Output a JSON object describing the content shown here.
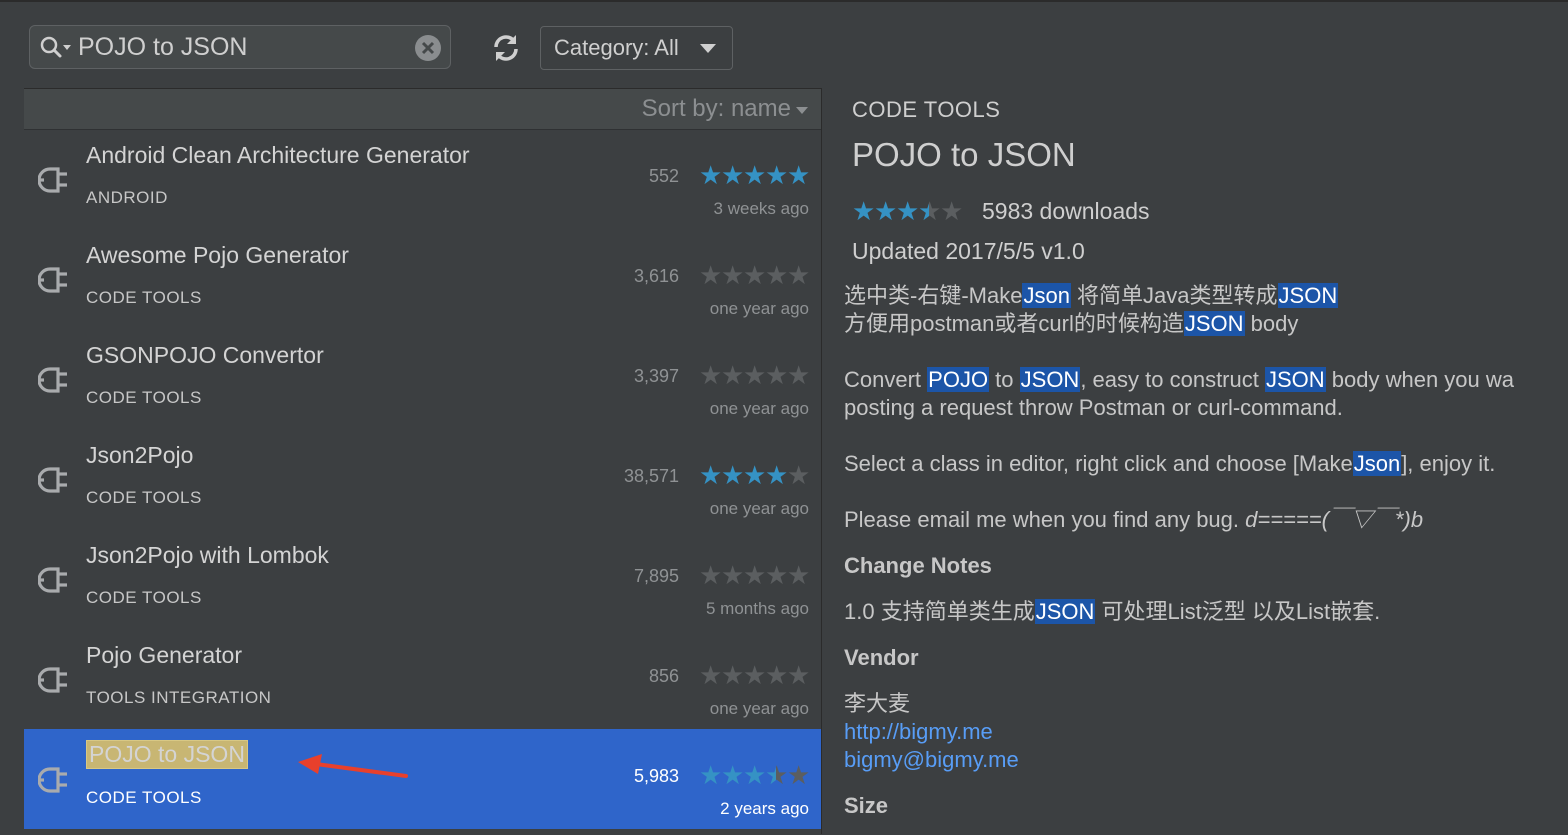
{
  "search": {
    "value": "POJO to JSON"
  },
  "category": {
    "label": "Category: All"
  },
  "sort": {
    "label": "Sort by: name"
  },
  "plugins": [
    {
      "name": "Android Clean Architecture Generator",
      "category": "ANDROID",
      "downloads": "552",
      "rating": 5,
      "updated": "3 weeks ago",
      "rated": true
    },
    {
      "name": "Awesome Pojo Generator",
      "category": "CODE TOOLS",
      "downloads": "3,616",
      "rating": 0,
      "updated": "one year ago",
      "rated": false
    },
    {
      "name": "GSONPOJO Convertor",
      "category": "CODE TOOLS",
      "downloads": "3,397",
      "rating": 0,
      "updated": "one year ago",
      "rated": false
    },
    {
      "name": "Json2Pojo",
      "category": "CODE TOOLS",
      "downloads": "38,571",
      "rating": 4,
      "updated": "one year ago",
      "rated": true
    },
    {
      "name": "Json2Pojo with Lombok",
      "category": "CODE TOOLS",
      "downloads": "7,895",
      "rating": 0,
      "updated": "5 months ago",
      "rated": false
    },
    {
      "name": "Pojo Generator",
      "category": "TOOLS INTEGRATION",
      "downloads": "856",
      "rating": 0,
      "updated": "one year ago",
      "rated": false
    },
    {
      "name": "POJO to JSON",
      "category": "CODE TOOLS",
      "downloads": "5,983",
      "rating": 3.5,
      "updated": "2 years ago",
      "rated": true,
      "selected": true
    }
  ],
  "detail": {
    "category": "CODE TOOLS",
    "title": "POJO to JSON",
    "rating": 3.5,
    "downloads": "5983 downloads",
    "updated": "Updated 2017/5/5   v1.0",
    "line1_a": "选中类-右键-Make",
    "line1_b": "Json",
    "line1_c": " 将简单Java类型转成",
    "line1_d": "JSON",
    "line2_a": "方便用postman或者curl的时候构造",
    "line2_b": "JSON",
    "line2_c": " body",
    "p2_a": "Convert ",
    "p2_b": "POJO",
    "p2_c": " to ",
    "p2_d": "JSON",
    "p2_e": ", easy to construct ",
    "p2_f": "JSON",
    "p2_g": " body when you wa",
    "p2_line2": "posting a request throw Postman or curl-command.",
    "p3_a": "Select a class in editor, right click and choose [Make",
    "p3_b": "Json",
    "p3_c": "], enjoy it.",
    "p4_a": "Please email me when you find any bug. ",
    "p4_b": "d=====(￣▽￣*)b",
    "change_notes_h": "Change Notes",
    "change_a": "1.0 支持简单类生成",
    "change_b": "JSON",
    "change_c": " 可处理List泛型 以及List嵌套.",
    "vendor_h": "Vendor",
    "vendor_name": "李大麦",
    "vendor_url": "http://bigmy.me",
    "vendor_email": "bigmy@bigmy.me",
    "size_h": "Size"
  },
  "colors": {
    "selection": "#2f65ca",
    "star_on": "#3592c4",
    "star_off": "#5b5e60",
    "highlight": "#1c55a8",
    "arrow": "#e8402c"
  }
}
